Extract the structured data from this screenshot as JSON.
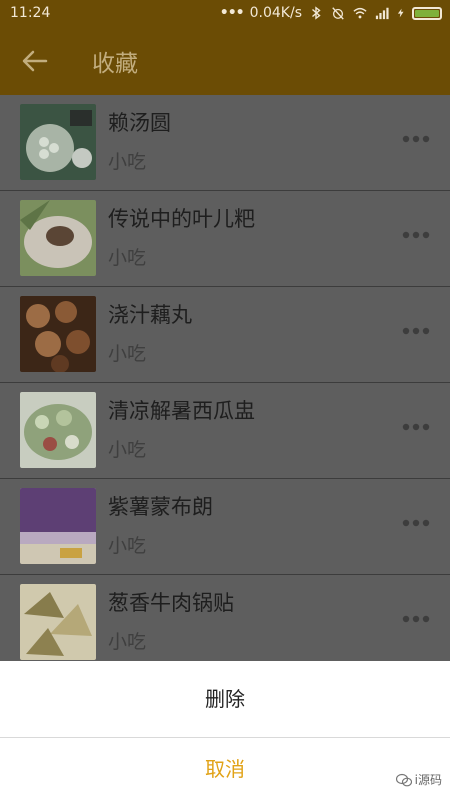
{
  "status": {
    "time": "11:24",
    "dots": "•••",
    "speed": "0.04K/s",
    "icons": [
      "bluetooth-icon",
      "alarm-off-icon",
      "wifi-icon",
      "signal-icon",
      "charging-icon",
      "battery-icon"
    ]
  },
  "header": {
    "title": "收藏",
    "back_icon": "arrow-left-icon"
  },
  "items": [
    {
      "name": "赖汤圆",
      "category": "小吃",
      "thumb_colors": [
        "#3b5443",
        "#a8b4a6",
        "#2a2f2c"
      ]
    },
    {
      "name": "传说中的叶儿粑",
      "category": "小吃",
      "thumb_colors": [
        "#7b8f5e",
        "#c9c3b7",
        "#5a4535"
      ]
    },
    {
      "name": "浇汁藕丸",
      "category": "小吃",
      "thumb_colors": [
        "#5f3a22",
        "#9c6c45",
        "#3c2617"
      ]
    },
    {
      "name": "清凉解暑西瓜盅",
      "category": "小吃",
      "thumb_colors": [
        "#8fa27b",
        "#c8cdc0",
        "#9a4d44"
      ]
    },
    {
      "name": "紫薯蒙布朗",
      "category": "小吃",
      "thumb_colors": [
        "#5d3f74",
        "#b9a9c0",
        "#cfc7b3"
      ]
    },
    {
      "name": "葱香牛肉锅贴",
      "category": "小吃",
      "thumb_colors": [
        "#877c4c",
        "#b5a878",
        "#d0c9ad"
      ]
    }
  ],
  "sheet": {
    "delete_label": "删除",
    "cancel_label": "取消"
  },
  "watermark": {
    "text": "i源码"
  },
  "colors": {
    "header_bg": "#6b4c05",
    "accent": "#e1a216",
    "overlay": "#5e5e5e"
  }
}
